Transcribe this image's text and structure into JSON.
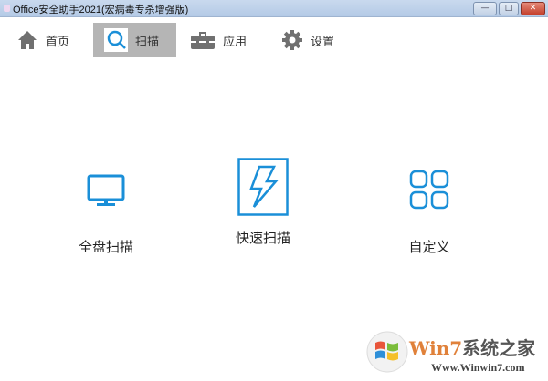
{
  "window": {
    "title": "Office安全助手2021(宏病毒专杀增强版)",
    "minimize": "—",
    "maximize": "□",
    "close": "✕"
  },
  "nav": [
    {
      "label": "首页",
      "icon": "home-icon"
    },
    {
      "label": "扫描",
      "icon": "search-icon"
    },
    {
      "label": "应用",
      "icon": "toolbox-icon"
    },
    {
      "label": "设置",
      "icon": "gear-icon"
    }
  ],
  "scan_options": [
    {
      "label": "全盘扫描",
      "icon": "monitor-icon"
    },
    {
      "label": "快速扫描",
      "icon": "lightning-icon"
    },
    {
      "label": "自定义",
      "icon": "grid-icon"
    }
  ],
  "watermark": {
    "brand": "Win7",
    "brand_suffix": "系统之家",
    "url": "Www.Winwin7.com"
  },
  "colors": {
    "accent": "#1a8fd8",
    "active_tab": "#b5b5b5"
  }
}
